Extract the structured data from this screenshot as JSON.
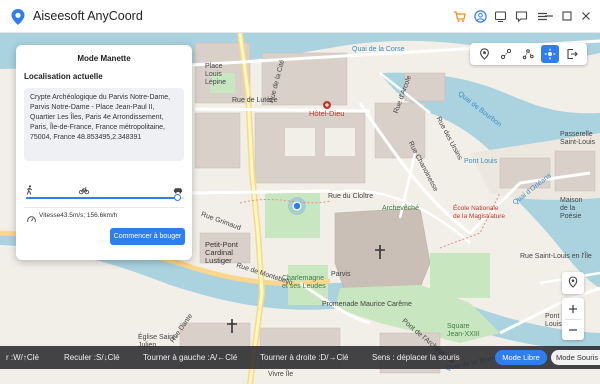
{
  "app": {
    "title": "Aiseesoft AnyCoord"
  },
  "titlebar_icons": [
    "cart-icon",
    "user-icon",
    "support-icon",
    "feedback-icon",
    "menu-icon",
    "minimize-icon",
    "maximize-icon",
    "close-icon"
  ],
  "map_toolbar_icons": [
    "teleport-icon",
    "one-stop-icon",
    "multi-stop-icon",
    "joystick-icon",
    "export-icon"
  ],
  "map": {
    "labels": {
      "quai_corse": "Quai de la Corse",
      "place_louis_lepine": "Place\nLouis\nLépine",
      "rue_cite": "Rue de la Cité",
      "rue_lutece": "Rue de Lutèce",
      "hotel_dieu": "Hôtel-Dieu",
      "rue_arcole": "Rue d'Arcole",
      "rue_chanoinesse": "Rue Chanoinesse",
      "rue_ursins": "Rue des Ursins",
      "quai_bourbon": "Quai de Bourbon",
      "pont_louis": "Pont Louis",
      "rue_cloitre": "Rue du Cloître",
      "archeveche": "Archevêché",
      "ecole_magistrature": "École Nationale\nde la Magistrature",
      "quai_orleans": "Quai d'Orléans",
      "maison_poesie": "Maison\nde la\nPoésie",
      "rue_saint_louis": "Rue Saint-Louis en l'Île",
      "rue_grimaud": "Rue Grimaud",
      "petit_pont": "Petit-Pont\nCardinal\nLustiger",
      "rue_montebello": "Rue de Montebello",
      "promenade": "Promenade Maurice Carême",
      "square_jean": "Square\nJean-XXIII",
      "pont_saint_louis": "Pont Saint-\nLouis",
      "charlemagne": "Charlemagne\net ses Leudes",
      "parvis": "Parvis",
      "rue_dante": "Rue Dante",
      "saint_julien": "Église Saint-\nJulien",
      "quai_tournelle": "Quai de la Tournelle",
      "pont_archeveche": "Pont de l'Archevêché",
      "vivre_ile": "Vivre Île",
      "passerelle": "Passerelle\nSaint-Louis"
    }
  },
  "panel": {
    "title": "Mode Manette",
    "subtitle": "Localisation actuelle",
    "address": "Crypte Archéologique du Parvis Notre-Dame, Parvis Notre-Dame - Place Jean-Paul II, Quartier Les Îles, Paris 4e Arrondissement, Paris, Île-de-France, France métropolitaine, 75004, France 48.853495,2.348391",
    "movement_modes": [
      "walk-icon",
      "bike-icon",
      "car-icon"
    ],
    "speed_fraction": 0.96,
    "speed_text": "Vitesse43.5m/s; 156.6km/h",
    "start_button": "Commencer à bouger"
  },
  "hint_bar": {
    "forward": "r :W/↑Clé",
    "back": "Reculer :S/↓Clé",
    "left": "Tourner à gauche :A/←Clé",
    "right": "Tourner à droite :D/→Clé",
    "mouse": "Sens : déplacer la souris",
    "mode_libre": "Mode Libre",
    "mode_souris": "Mode Souris"
  },
  "colors": {
    "accent": "#2f7ef0",
    "water": "#aad3df",
    "park": "#c8e6c0",
    "building": "#d9d0c9",
    "road_major": "#f7fabf",
    "road_yellow": "#fcd68a"
  }
}
